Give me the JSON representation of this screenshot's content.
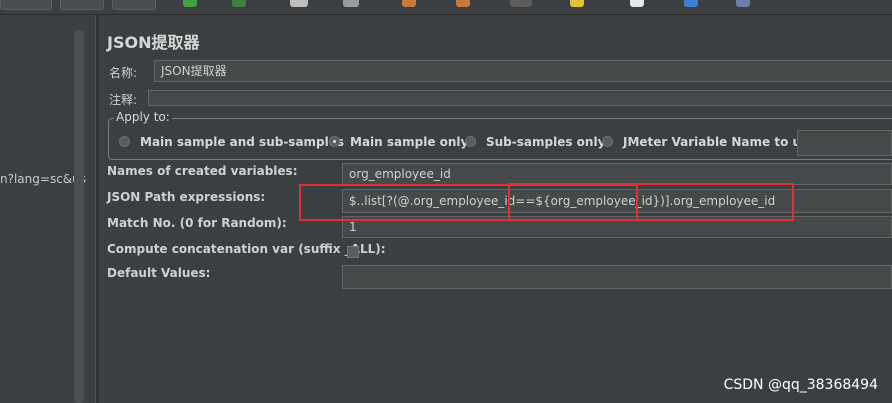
{
  "left_panel": {
    "tree_text": "n?lang=sc&us"
  },
  "panel": {
    "title": "JSON提取器",
    "name_label": "名称:",
    "name_value": "JSON提取器",
    "comment_label": "注释:",
    "comment_value": ""
  },
  "apply_to": {
    "title": "Apply to:",
    "options": [
      {
        "label": "Main sample and sub-samples",
        "selected": false
      },
      {
        "label": "Main sample only",
        "selected": true
      },
      {
        "label": "Sub-samples only",
        "selected": false
      },
      {
        "label": "JMeter Variable Name to use",
        "selected": false
      }
    ],
    "variable_value": ""
  },
  "fields": {
    "names_label": "Names of created variables:",
    "names_value": "org_employee_id",
    "path_label": "JSON Path expressions:",
    "path_value": "$..list[?(@.org_employee_id==${org_employee_id})].org_employee_id",
    "match_label": "Match No. (0 for Random):",
    "match_value": "1",
    "concat_label": "Compute concatenation var (suffix _ALL):",
    "concat_checked": false,
    "default_label": "Default Values:",
    "default_value": ""
  },
  "watermark": "CSDN @qq_38368494",
  "colors": {
    "background": "#3c3f41",
    "field_bg": "#45494a",
    "highlight": "#e03030"
  }
}
